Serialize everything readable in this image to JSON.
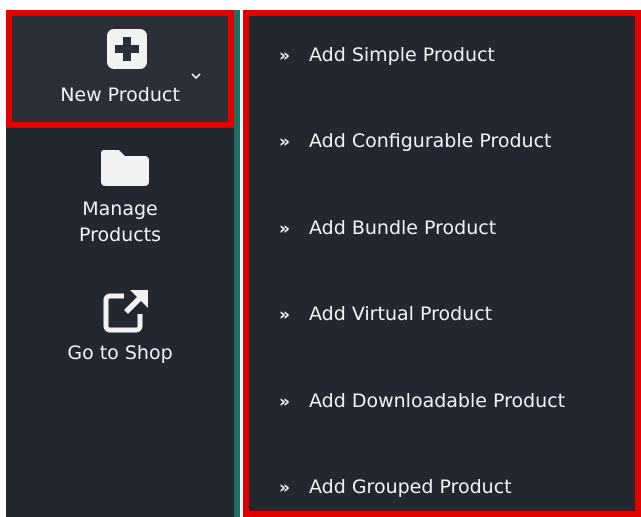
{
  "sidebar": {
    "new_product": {
      "label": "New Product",
      "icon": "plus-square-icon",
      "caret": "chevron-down-icon"
    },
    "manage_products": {
      "label_line1": "Manage",
      "label_line2": "Products",
      "icon": "folder-icon"
    },
    "go_to_shop": {
      "label": "Go to Shop",
      "icon": "external-link-icon"
    }
  },
  "submenu": {
    "chevron": "»",
    "items": [
      {
        "label": "Add Simple Product"
      },
      {
        "label": "Add Configurable Product"
      },
      {
        "label": "Add Bundle Product"
      },
      {
        "label": "Add Virtual Product"
      },
      {
        "label": "Add Downloadable Product"
      },
      {
        "label": "Add Grouped Product"
      }
    ]
  },
  "colors": {
    "panel_bg": "#222730",
    "highlight_border": "#e50000",
    "accent": "#1f6f63",
    "text": "#f2f2f2"
  }
}
